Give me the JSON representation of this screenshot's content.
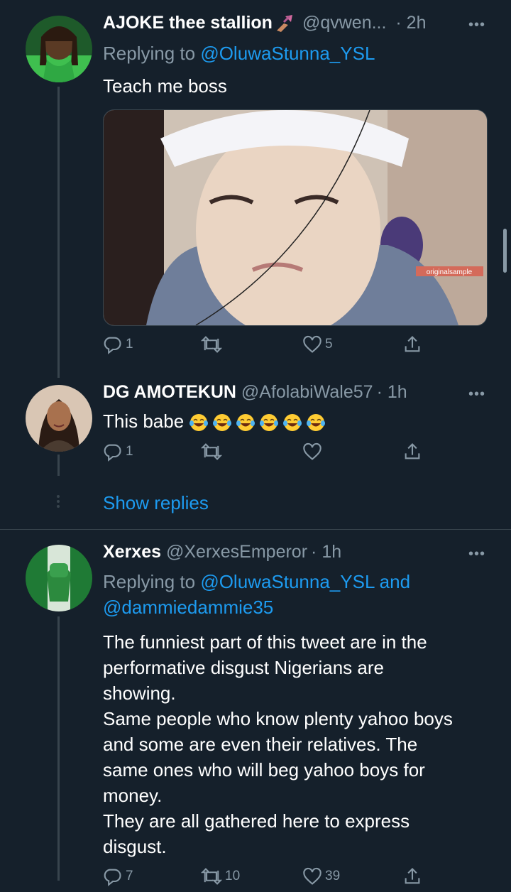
{
  "tweets": [
    {
      "name": "AJOKE thee stallion",
      "handle": "@qvwen...",
      "time": "· 2h",
      "reply_label": "Replying to",
      "reply_users": "@OluwaStunna_YSL",
      "text": "Teach me boss",
      "media_watermark": "originalsample",
      "stats": {
        "reply": "1",
        "retweet": "",
        "like": "5"
      }
    },
    {
      "name": "DG AMOTEKUN",
      "handle": "@AfolabiWale57",
      "time": "· 1h",
      "text": "This babe",
      "emoji_count": 6,
      "stats": {
        "reply": "1",
        "retweet": "",
        "like": ""
      }
    },
    {
      "name": "Xerxes",
      "handle": "@XerxesEmperor",
      "time": "· 1h",
      "reply_label": "Replying to",
      "reply_users_1": "@OluwaStunna_YSL and",
      "reply_users_2": "@dammiedammie35",
      "text_lines": [
        "The funniest part of this tweet are in the",
        "performative disgust Nigerians are",
        "showing.",
        "Same people who know plenty yahoo boys",
        "and some are even their relatives. The",
        "same ones who will beg yahoo boys for",
        "money.",
        "They are all gathered here to express",
        "disgust."
      ],
      "stats": {
        "reply": "7",
        "retweet": "10",
        "like": "39"
      }
    }
  ],
  "show_replies": "Show replies",
  "icons": {
    "more": "more-icon",
    "reply": "reply-icon",
    "retweet": "retweet-icon",
    "like": "like-icon",
    "share": "share-icon",
    "nail_polish": "nail-polish-emoji",
    "laughing": "tears-of-joy-emoji"
  },
  "colors": {
    "background": "#15202b",
    "link": "#1d9bf0",
    "muted": "#8899a6",
    "divider": "#38444d"
  }
}
